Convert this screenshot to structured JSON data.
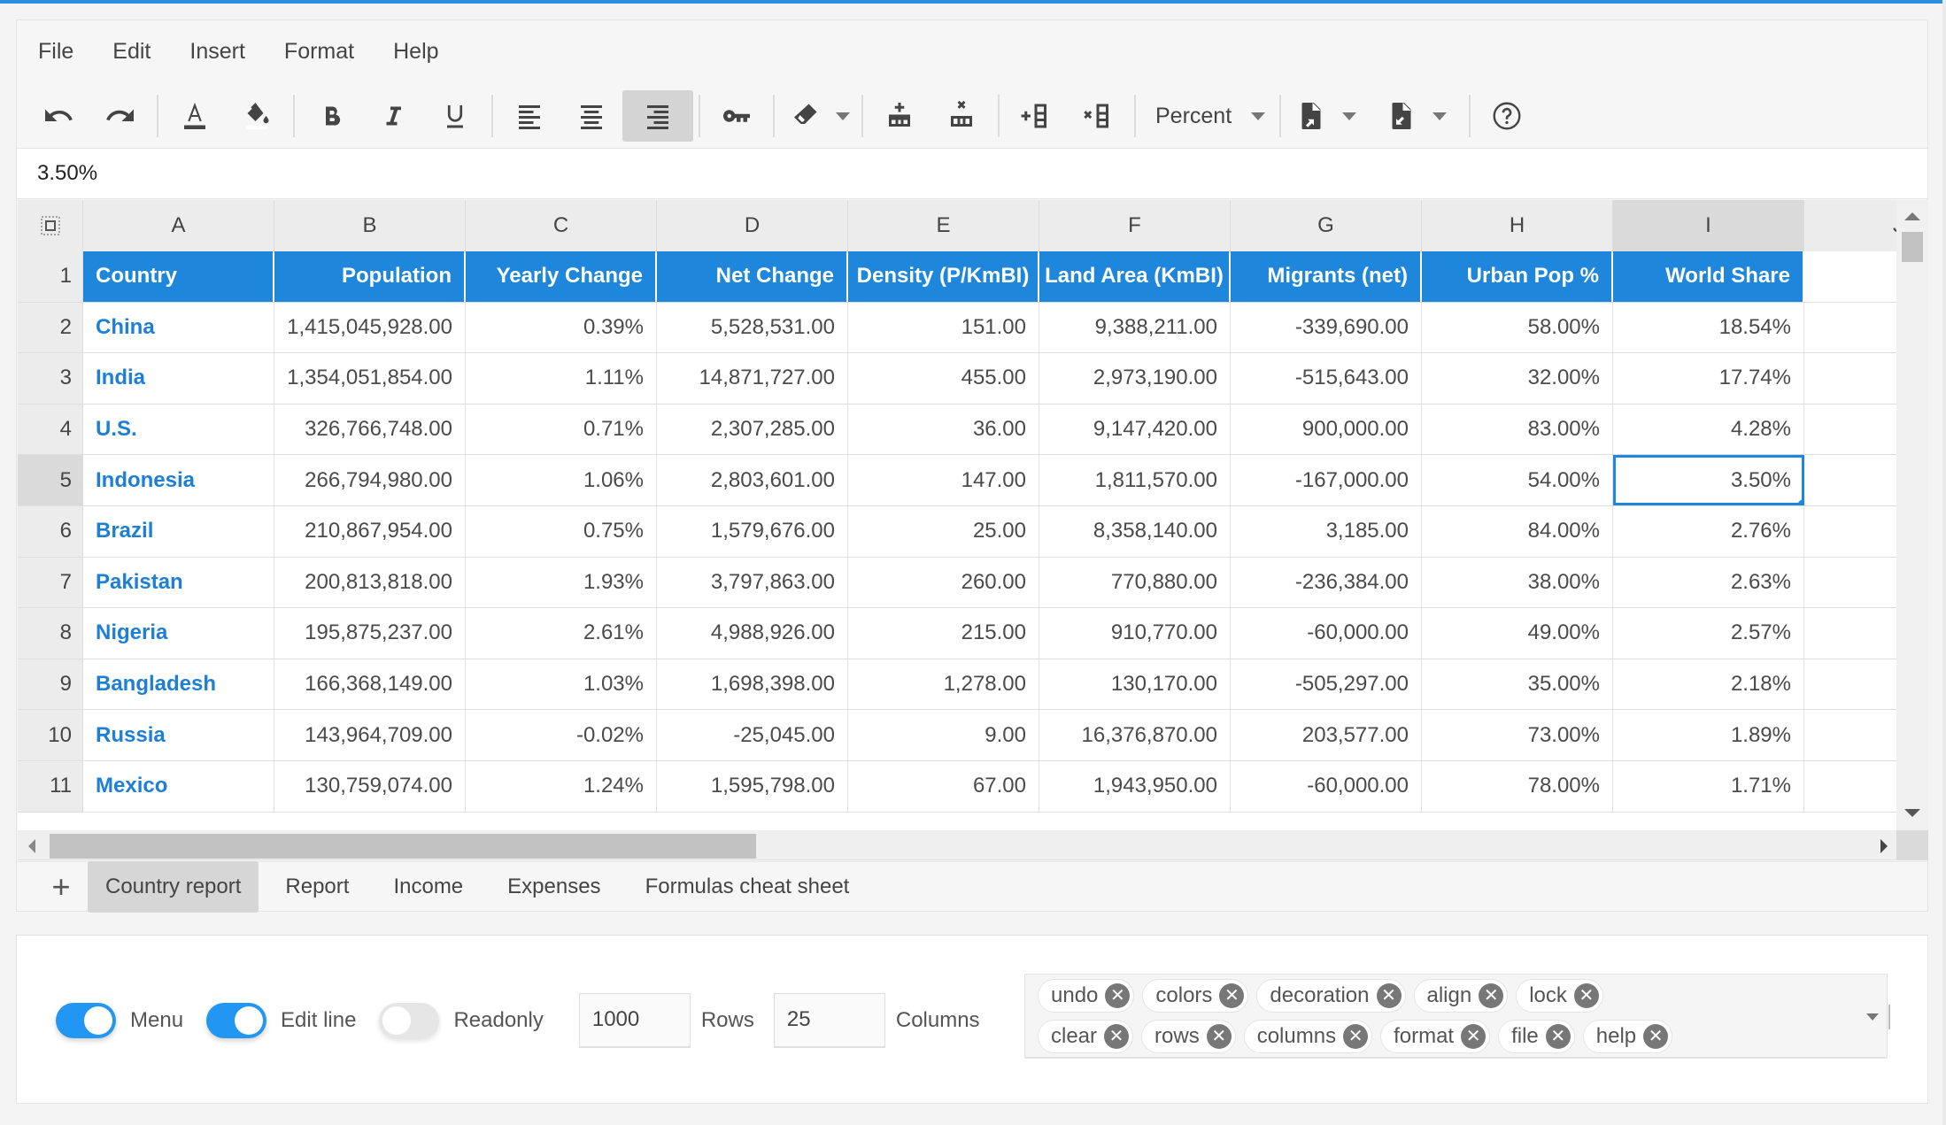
{
  "menu": [
    "File",
    "Edit",
    "Insert",
    "Format",
    "Help"
  ],
  "toolbar": {
    "buttons": [
      "undo-icon",
      "redo-icon",
      "text-color-icon",
      "background-color-icon",
      "bold-icon",
      "italic-icon",
      "underline-icon",
      "align-left-icon",
      "align-center-icon",
      "align-right-icon",
      "lock-key-icon",
      "clear-eraser-icon",
      "add-row-icon",
      "remove-row-icon",
      "add-column-icon",
      "remove-column-icon",
      "import-file-icon",
      "export-file-icon",
      "help-icon"
    ],
    "active_button": "align-right-icon",
    "format_select": "Percent",
    "text_color": "#444444",
    "background_color": "#ffffff"
  },
  "formula_bar": {
    "value": "3.50%"
  },
  "grid": {
    "columns": [
      "A",
      "B",
      "C",
      "D",
      "E",
      "F",
      "G",
      "H",
      "I",
      "J"
    ],
    "selected_column": "I",
    "selected_row": "5",
    "selected_cell": "I5",
    "header_row": [
      "Country",
      "Population",
      "Yearly Change",
      "Net Change",
      "Density (P/KmBI)",
      "Land Area (KmBI)",
      "Migrants (net)",
      "Urban Pop %",
      "World Share"
    ],
    "rows": [
      {
        "n": "2",
        "cells": [
          "China",
          "1,415,045,928.00",
          "0.39%",
          "5,528,531.00",
          "151.00",
          "9,388,211.00",
          "-339,690.00",
          "58.00%",
          "18.54%"
        ]
      },
      {
        "n": "3",
        "cells": [
          "India",
          "1,354,051,854.00",
          "1.11%",
          "14,871,727.00",
          "455.00",
          "2,973,190.00",
          "-515,643.00",
          "32.00%",
          "17.74%"
        ]
      },
      {
        "n": "4",
        "cells": [
          "U.S.",
          "326,766,748.00",
          "0.71%",
          "2,307,285.00",
          "36.00",
          "9,147,420.00",
          "900,000.00",
          "83.00%",
          "4.28%"
        ]
      },
      {
        "n": "5",
        "cells": [
          "Indonesia",
          "266,794,980.00",
          "1.06%",
          "2,803,601.00",
          "147.00",
          "1,811,570.00",
          "-167,000.00",
          "54.00%",
          "3.50%"
        ]
      },
      {
        "n": "6",
        "cells": [
          "Brazil",
          "210,867,954.00",
          "0.75%",
          "1,579,676.00",
          "25.00",
          "8,358,140.00",
          "3,185.00",
          "84.00%",
          "2.76%"
        ]
      },
      {
        "n": "7",
        "cells": [
          "Pakistan",
          "200,813,818.00",
          "1.93%",
          "3,797,863.00",
          "260.00",
          "770,880.00",
          "-236,384.00",
          "38.00%",
          "2.63%"
        ]
      },
      {
        "n": "8",
        "cells": [
          "Nigeria",
          "195,875,237.00",
          "2.61%",
          "4,988,926.00",
          "215.00",
          "910,770.00",
          "-60,000.00",
          "49.00%",
          "2.57%"
        ]
      },
      {
        "n": "9",
        "cells": [
          "Bangladesh",
          "166,368,149.00",
          "1.03%",
          "1,698,398.00",
          "1,278.00",
          "130,170.00",
          "-505,297.00",
          "35.00%",
          "2.18%"
        ]
      },
      {
        "n": "10",
        "cells": [
          "Russia",
          "143,964,709.00",
          "-0.02%",
          "-25,045.00",
          "9.00",
          "16,376,870.00",
          "203,577.00",
          "73.00%",
          "1.89%"
        ]
      },
      {
        "n": "11",
        "cells": [
          "Mexico",
          "130,759,074.00",
          "1.24%",
          "1,595,798.00",
          "67.00",
          "1,943,950.00",
          "-60,000.00",
          "78.00%",
          "1.71%"
        ]
      }
    ],
    "header_color": "#1e87db",
    "link_color": "#1e7fd6"
  },
  "tabs": {
    "add_icon": "plus-icon",
    "items": [
      "Country report",
      "Report",
      "Income",
      "Expenses",
      "Formulas cheat sheet"
    ],
    "active": "Country report"
  },
  "settings": {
    "toggles": [
      {
        "label": "Menu",
        "on": true
      },
      {
        "label": "Edit line",
        "on": true
      },
      {
        "label": "Readonly",
        "on": false
      }
    ],
    "rows_value": "1000",
    "rows_label": "Rows",
    "columns_value": "25",
    "columns_label": "Columns",
    "toolbar_chips": [
      [
        "undo",
        "colors",
        "decoration",
        "align",
        "lock"
      ],
      [
        "clear",
        "rows",
        "columns",
        "format",
        "file",
        "help"
      ]
    ],
    "accent": "#2196f3"
  }
}
